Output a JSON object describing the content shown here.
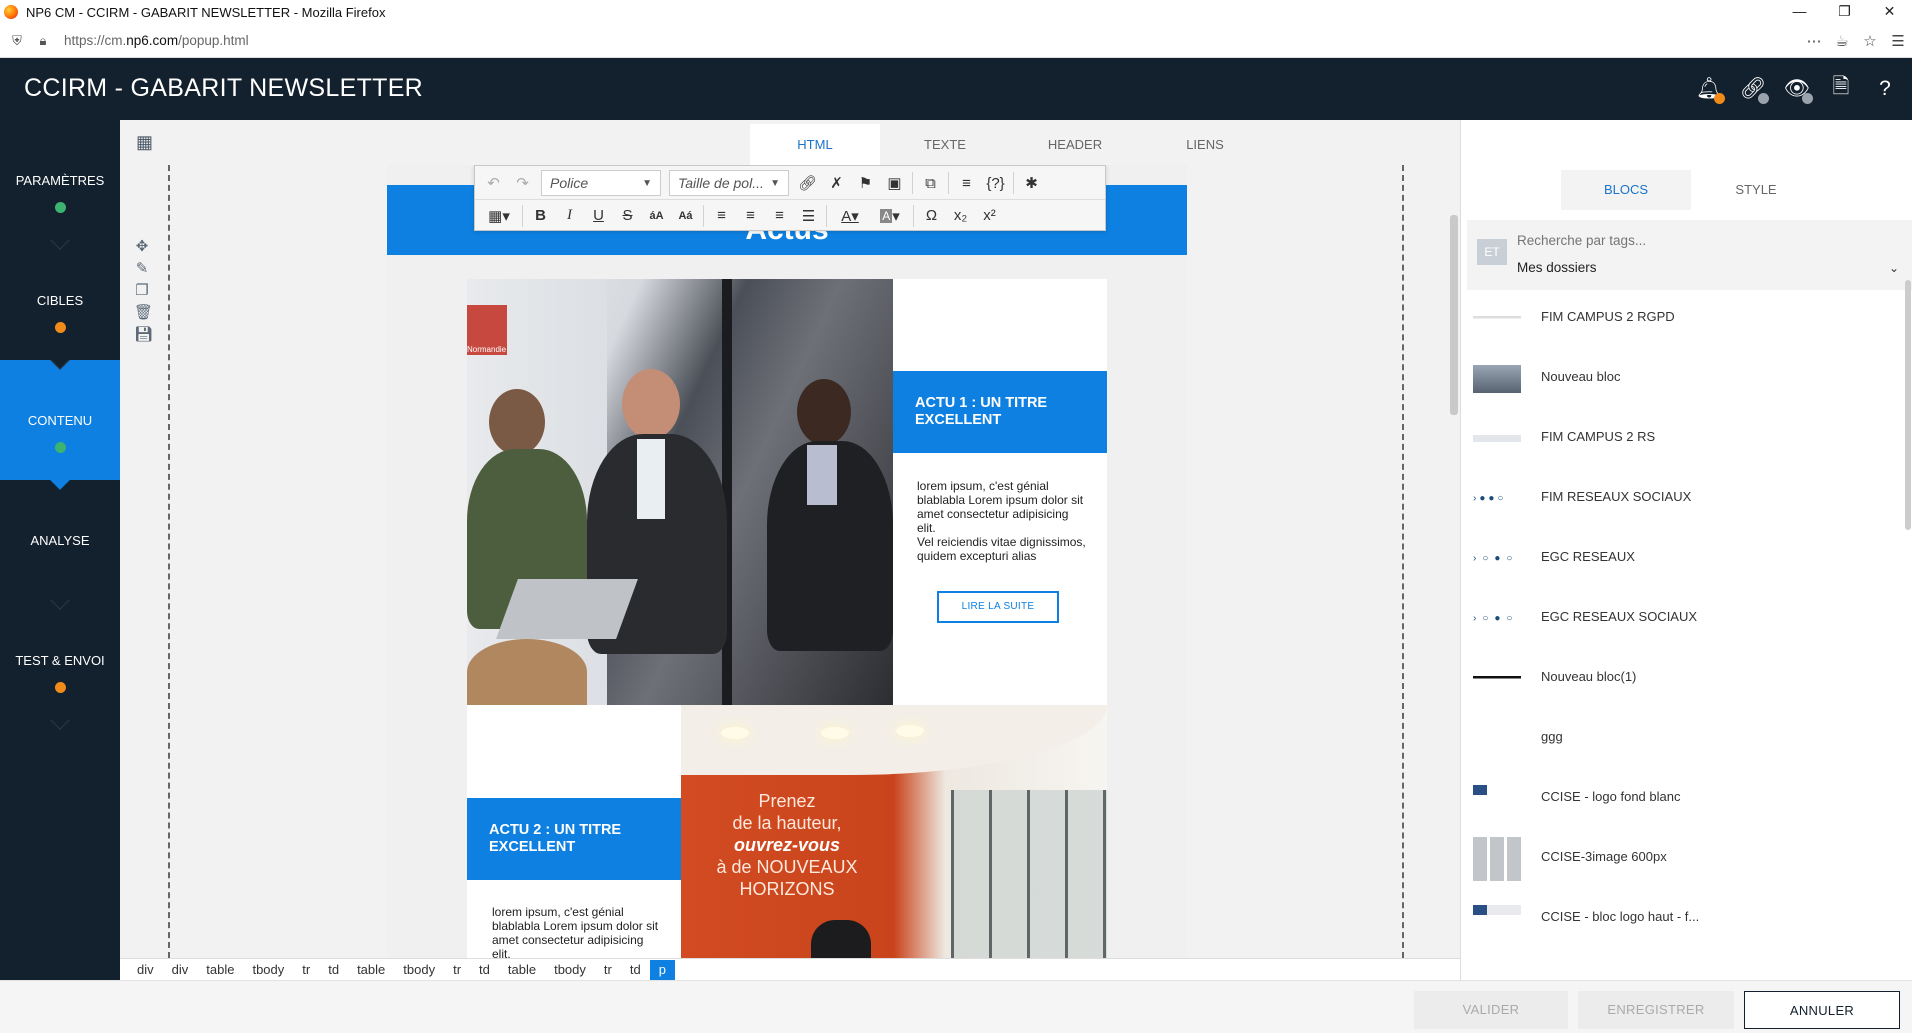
{
  "browser": {
    "window_title": "NP6 CM - CCIRM - GABARIT NEWSLETTER - Mozilla Firefox",
    "url_prefix": "https://cm.",
    "url_domain": "np6.com",
    "url_path": "/popup.html"
  },
  "header": {
    "title": "CCIRM - GABARIT NEWSLETTER",
    "icons": [
      "bell-icon",
      "link-icon",
      "eye-icon",
      "file-code-icon",
      "help-icon"
    ]
  },
  "sidebar": {
    "items": [
      {
        "label": "PARAMÈTRES",
        "status_color": "#3cb371"
      },
      {
        "label": "CIBLES",
        "status_color": "#f08b1a"
      },
      {
        "label": "CONTENU",
        "status_color": "#3cb371"
      },
      {
        "label": "ANALYSE",
        "status_color": ""
      },
      {
        "label": "TEST & ENVOI",
        "status_color": "#f08b1a"
      }
    ]
  },
  "editor": {
    "tabs": [
      "HTML",
      "TEXTE",
      "HEADER",
      "LIENS"
    ],
    "active_tab": "HTML",
    "toolbar": {
      "font_select": "Police",
      "size_select": "Taille de pol..."
    },
    "newsletter": {
      "header_text": "Actus",
      "actu1_title": "ACTU 1 : UN TITRE EXCELLENT",
      "actu1_text": "lorem ipsum, c'est génial blablabla Lorem ipsum dolor sit amet consectetur adipisicing elit.",
      "actu1_text2": "Vel reiciendis vitae dignissimos, quidem excepturi alias",
      "read_more": "LIRE LA SUITE",
      "actu2_title": "ACTU 2 : UN TITRE EXCELLENT",
      "actu2_text": "lorem ipsum, c'est génial blablabla Lorem ipsum dolor sit amet consectetur adipisicing elit.",
      "photo1_logo": "Normandie",
      "photo2_line1": "Prenez",
      "photo2_line2": "de la hauteur,",
      "photo2_line3": "ouvrez-vous",
      "photo2_line4": "à de NOUVEAUX",
      "photo2_line5": "HORIZONS"
    },
    "breadcrumb": [
      "div",
      "div",
      "table",
      "tbody",
      "tr",
      "td",
      "table",
      "tbody",
      "tr",
      "td",
      "table",
      "tbody",
      "tr",
      "td",
      "p"
    ]
  },
  "right_panel": {
    "tabs": [
      "BLOCS",
      "STYLE"
    ],
    "active_tab": "BLOCS",
    "et_label": "ET",
    "search_placeholder": "Recherche par tags...",
    "folder": "Mes dossiers",
    "blocks": [
      "FIM CAMPUS 2 RGPD",
      "Nouveau bloc",
      "FIM CAMPUS 2 RS",
      "FIM RESEAUX SOCIAUX",
      "EGC RESEAUX",
      "EGC RESEAUX SOCIAUX",
      "Nouveau bloc(1)",
      "ggg",
      "CCISE - logo fond blanc",
      "CCISE-3image 600px",
      "CCISE - bloc logo haut - f..."
    ]
  },
  "footer": {
    "validate": "VALIDER",
    "save": "ENREGISTRER",
    "cancel": "ANNULER"
  },
  "colors": {
    "brand_dark": "#13202d",
    "accent_blue": "#0d80e1",
    "status_green": "#3cb371",
    "status_orange": "#f08b1a"
  }
}
